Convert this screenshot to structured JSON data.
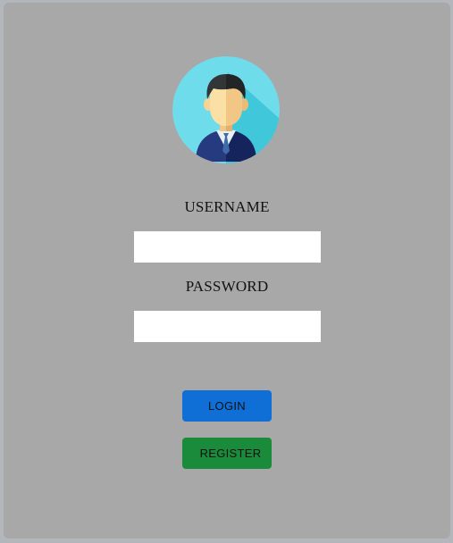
{
  "form": {
    "username_label": "USERNAME",
    "password_label": "PASSWORD",
    "username_value": "",
    "password_value": "",
    "login_label": "LOGIN",
    "register_label": "REGISTER"
  },
  "icons": {
    "avatar": "user-avatar-icon"
  },
  "colors": {
    "card_background": "#a8a8a8",
    "page_background": "#b3b7bb",
    "login_button": "#0f6fd6",
    "register_button": "#1a8b3a",
    "avatar_circle": "#6fdcec"
  }
}
